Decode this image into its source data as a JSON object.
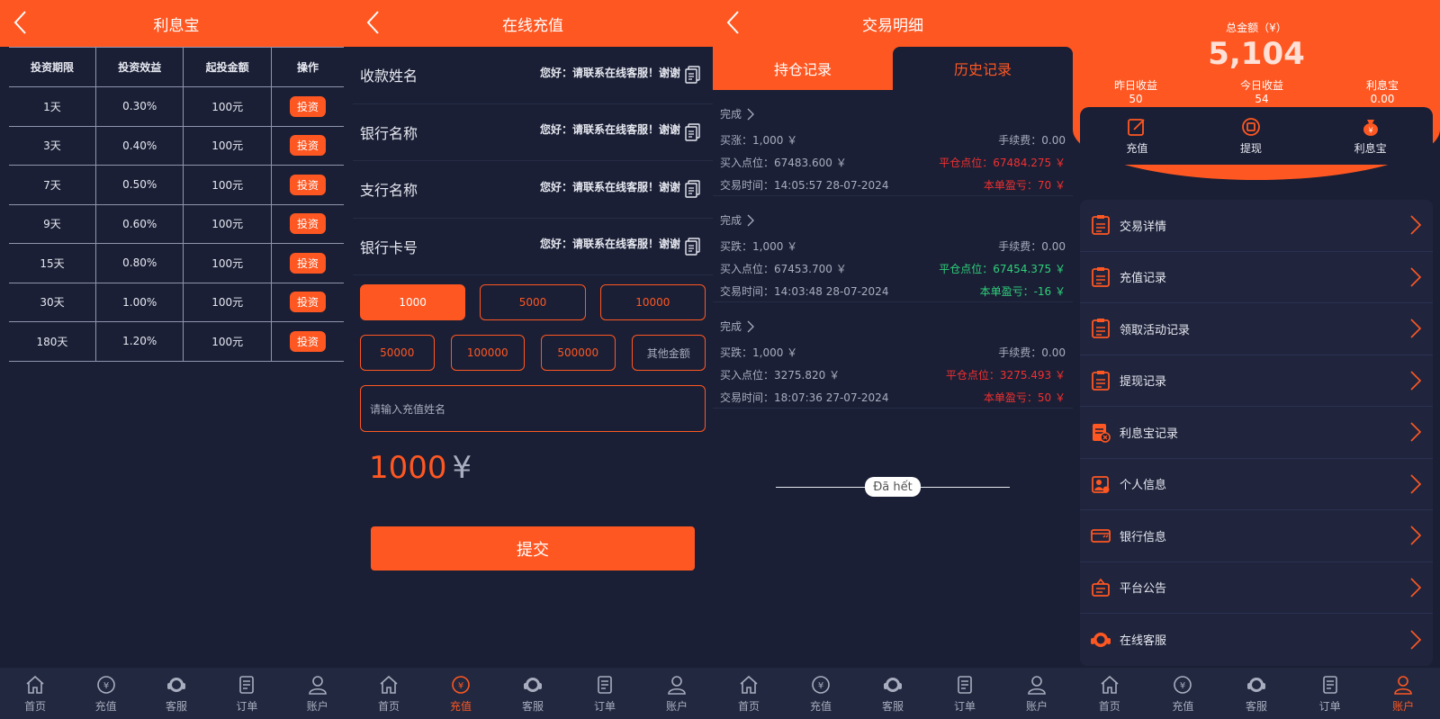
{
  "screen1": {
    "title": "利息宝",
    "headers": [
      "投资期限",
      "投资效益",
      "起投金额",
      "操作"
    ],
    "rows": [
      [
        "1天",
        "0.30%",
        "100元",
        "投资"
      ],
      [
        "3天",
        "0.40%",
        "100元",
        "投资"
      ],
      [
        "7天",
        "0.50%",
        "100元",
        "投资"
      ],
      [
        "9天",
        "0.60%",
        "100元",
        "投资"
      ],
      [
        "15天",
        "0.80%",
        "100元",
        "投资"
      ],
      [
        "30天",
        "1.00%",
        "100元",
        "投资"
      ],
      [
        "180天",
        "1.20%",
        "100元",
        "投资"
      ]
    ]
  },
  "screen2": {
    "title": "在线充值",
    "fields": [
      {
        "label": "收款姓名",
        "value": "您好：请联系在线客服！谢谢"
      },
      {
        "label": "银行名称",
        "value": "您好：请联系在线客服！谢谢"
      },
      {
        "label": "支行名称",
        "value": "您好：请联系在线客服！谢谢"
      },
      {
        "label": "银行卡号",
        "value": "您好：请联系在线客服！谢谢"
      }
    ],
    "amounts_row1": [
      "1000",
      "5000",
      "10000"
    ],
    "amounts_row2": [
      "50000",
      "100000",
      "500000"
    ],
    "other_amount": "其他金额",
    "name_placeholder": "请输入充值姓名",
    "big_amount": "1000",
    "currency": "¥",
    "submit": "提交"
  },
  "screen3": {
    "title": "交易明细",
    "tabs": [
      "持仓记录",
      "历史记录"
    ],
    "trades": [
      {
        "status": "完成",
        "buy": "买涨：1,000 ￥",
        "fee": "手续费：0.00",
        "entry": "买入点位：67483.600 ￥",
        "exit": "平仓点位：67484.275 ￥",
        "time": "交易时间：14:05:57 28-07-2024",
        "pnl": "本单盈亏：70 ￥",
        "color": "#f23030"
      },
      {
        "status": "完成",
        "buy": "买跌：1,000 ￥",
        "fee": "手续费：0.00",
        "entry": "买入点位：67453.700 ￥",
        "exit": "平仓点位：67454.375 ￥",
        "time": "交易时间：14:03:48 28-07-2024",
        "pnl": "本单盈亏：-16 ￥",
        "color": "#2fd07a"
      },
      {
        "status": "完成",
        "buy": "买跌：1,000 ￥",
        "fee": "手续费：0.00",
        "entry": "买入点位：3275.820 ￥",
        "exit": "平仓点位：3275.493 ￥",
        "time": "交易时间：18:07:36 27-07-2024",
        "pnl": "本单盈亏：50 ￥",
        "color": "#f23030"
      }
    ],
    "end_label": "Đã hết"
  },
  "screen4": {
    "total_label": "总金额（¥）",
    "total": "5,104",
    "stats": [
      {
        "label": "昨日收益",
        "value": "50"
      },
      {
        "label": "今日收益",
        "value": "54"
      },
      {
        "label": "利息宝",
        "value": "0.00"
      }
    ],
    "quick": [
      {
        "label": "充值",
        "icon": "edit-icon"
      },
      {
        "label": "提现",
        "icon": "withdraw-icon"
      },
      {
        "label": "利息宝",
        "icon": "moneybag-icon"
      }
    ],
    "menu": [
      {
        "label": "交易详情"
      },
      {
        "label": "充值记录"
      },
      {
        "label": "领取活动记录"
      },
      {
        "label": "提现记录"
      },
      {
        "label": "利息宝记录"
      },
      {
        "label": "个人信息"
      },
      {
        "label": "银行信息"
      },
      {
        "label": "平台公告"
      },
      {
        "label": "在线客服"
      }
    ]
  },
  "nav": [
    "首页",
    "充值",
    "客服",
    "订单",
    "账户"
  ],
  "colors": {
    "accent": "#ff5722",
    "bg": "#1a1f35",
    "nav_bg": "#22283f",
    "profit": "#f23030",
    "loss": "#2fd07a"
  }
}
